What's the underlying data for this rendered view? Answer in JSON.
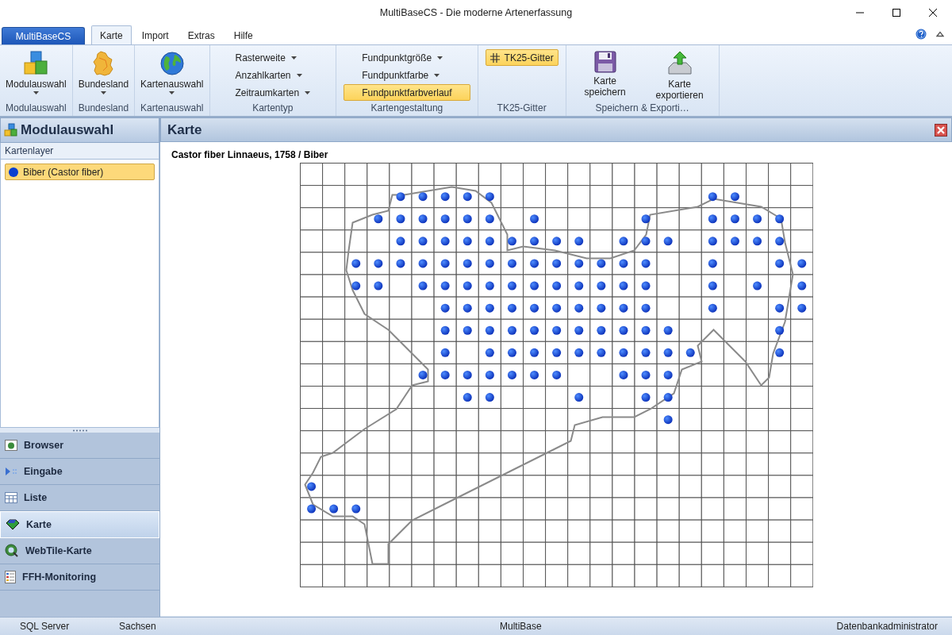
{
  "window": {
    "title": "MultiBaseCS - Die moderne Artenerfassung"
  },
  "ribbon": {
    "app_button": "MultiBaseCS",
    "tabs": [
      {
        "label": "Karte",
        "selected": true
      },
      {
        "label": "Import",
        "selected": false
      },
      {
        "label": "Extras",
        "selected": false
      },
      {
        "label": "Hilfe",
        "selected": false
      }
    ],
    "groups": [
      {
        "label": "Modulauswahl",
        "items": [
          {
            "kind": "large",
            "label": "Modulauswahl",
            "dropdown": true
          }
        ]
      },
      {
        "label": "Bundesland",
        "items": [
          {
            "kind": "large",
            "label": "Bundesland",
            "dropdown": true
          }
        ]
      },
      {
        "label": "Kartenauswahl",
        "items": [
          {
            "kind": "large",
            "label": "Kartenauswahl",
            "dropdown": true
          }
        ]
      },
      {
        "label": "Kartentyp",
        "items": [
          {
            "kind": "dropdown",
            "label": "Rasterweite"
          },
          {
            "kind": "dropdown",
            "label": "Anzahlkarten"
          },
          {
            "kind": "dropdown",
            "label": "Zeitraumkarten"
          }
        ]
      },
      {
        "label": "Kartengestaltung",
        "items": [
          {
            "kind": "dropdown",
            "label": "Fundpunktgröße"
          },
          {
            "kind": "dropdown",
            "label": "Fundpunktfarbe"
          },
          {
            "kind": "toggle",
            "label": "Fundpunktfarbverlauf",
            "selected": true
          }
        ]
      },
      {
        "label": "TK25-Gitter",
        "items": [
          {
            "kind": "toggle",
            "label": "TK25-Gitter",
            "selected": true
          }
        ]
      },
      {
        "label": "Speichern & Exporti…",
        "items": [
          {
            "kind": "large",
            "label": "Karte speichern"
          },
          {
            "kind": "large",
            "label": "Karte exportieren"
          }
        ]
      }
    ]
  },
  "sidebar": {
    "title": "Modulauswahl",
    "section": "Kartenlayer",
    "layers": [
      {
        "label": "Biber (Castor fiber)",
        "color": "#0a3fd0",
        "selected": true
      }
    ],
    "nav": [
      {
        "label": "Browser",
        "selected": false
      },
      {
        "label": "Eingabe",
        "selected": false
      },
      {
        "label": "Liste",
        "selected": false
      },
      {
        "label": "Karte",
        "selected": true
      },
      {
        "label": "WebTile-Karte",
        "selected": false
      },
      {
        "label": "FFH-Monitoring",
        "selected": false
      }
    ]
  },
  "panel": {
    "title": "Karte",
    "map": {
      "title": "Castor fiber Linnaeus, 1758 / Biber",
      "grid": [
        [
          false,
          false,
          false,
          false,
          false,
          false,
          false,
          false,
          false,
          false,
          false,
          false,
          false,
          false,
          false,
          false,
          false,
          false,
          false,
          false,
          false,
          false,
          false
        ],
        [
          false,
          false,
          false,
          false,
          true,
          true,
          true,
          true,
          true,
          false,
          false,
          false,
          false,
          false,
          false,
          false,
          false,
          false,
          true,
          true,
          false,
          false,
          false
        ],
        [
          false,
          false,
          false,
          true,
          true,
          true,
          true,
          true,
          true,
          false,
          true,
          false,
          false,
          false,
          false,
          true,
          false,
          false,
          true,
          true,
          true,
          true,
          false
        ],
        [
          false,
          false,
          false,
          false,
          true,
          true,
          true,
          true,
          true,
          true,
          true,
          true,
          true,
          false,
          true,
          true,
          true,
          false,
          true,
          true,
          true,
          true,
          false
        ],
        [
          false,
          false,
          true,
          true,
          true,
          true,
          true,
          true,
          true,
          true,
          true,
          true,
          true,
          true,
          true,
          true,
          false,
          false,
          true,
          false,
          false,
          true,
          true
        ],
        [
          false,
          false,
          true,
          true,
          false,
          true,
          true,
          true,
          true,
          true,
          true,
          true,
          true,
          true,
          true,
          true,
          false,
          false,
          true,
          false,
          true,
          false,
          true
        ],
        [
          false,
          false,
          false,
          false,
          false,
          false,
          true,
          true,
          true,
          true,
          true,
          true,
          true,
          true,
          true,
          true,
          false,
          false,
          true,
          false,
          false,
          true,
          true
        ],
        [
          false,
          false,
          false,
          false,
          false,
          false,
          true,
          true,
          true,
          true,
          true,
          true,
          true,
          true,
          true,
          true,
          true,
          false,
          false,
          false,
          false,
          true,
          false
        ],
        [
          false,
          false,
          false,
          false,
          false,
          false,
          true,
          false,
          true,
          true,
          true,
          true,
          true,
          true,
          true,
          true,
          true,
          true,
          false,
          false,
          false,
          true,
          false
        ],
        [
          false,
          false,
          false,
          false,
          false,
          true,
          true,
          true,
          true,
          true,
          true,
          true,
          false,
          false,
          true,
          true,
          true,
          false,
          false,
          false,
          false,
          false,
          false
        ],
        [
          false,
          false,
          false,
          false,
          false,
          false,
          false,
          true,
          true,
          false,
          false,
          false,
          true,
          false,
          false,
          true,
          true,
          false,
          false,
          false,
          false,
          false,
          false
        ],
        [
          false,
          false,
          false,
          false,
          false,
          false,
          false,
          false,
          false,
          false,
          false,
          false,
          false,
          false,
          false,
          false,
          true,
          false,
          false,
          false,
          false,
          false,
          false
        ],
        [
          false,
          false,
          false,
          false,
          false,
          false,
          false,
          false,
          false,
          false,
          false,
          false,
          false,
          false,
          false,
          false,
          false,
          false,
          false,
          false,
          false,
          false,
          false
        ],
        [
          false,
          false,
          false,
          false,
          false,
          false,
          false,
          false,
          false,
          false,
          false,
          false,
          false,
          false,
          false,
          false,
          false,
          false,
          false,
          false,
          false,
          false,
          false
        ],
        [
          true,
          false,
          false,
          false,
          false,
          false,
          false,
          false,
          false,
          false,
          false,
          false,
          false,
          false,
          false,
          false,
          false,
          false,
          false,
          false,
          false,
          false,
          false
        ],
        [
          true,
          true,
          true,
          false,
          false,
          false,
          false,
          false,
          false,
          false,
          false,
          false,
          false,
          false,
          false,
          false,
          false,
          false,
          false,
          false,
          false,
          false,
          false
        ],
        [
          false,
          false,
          false,
          false,
          false,
          false,
          false,
          false,
          false,
          false,
          false,
          false,
          false,
          false,
          false,
          false,
          false,
          false,
          false,
          false,
          false,
          false,
          false
        ],
        [
          false,
          false,
          false,
          false,
          false,
          false,
          false,
          false,
          false,
          false,
          false,
          false,
          false,
          false,
          false,
          false,
          false,
          false,
          false,
          false,
          false,
          false,
          false
        ],
        [
          false,
          false,
          false,
          false,
          false,
          false,
          false,
          false,
          false,
          false,
          false,
          false,
          false,
          false,
          false,
          false,
          false,
          false,
          false,
          false,
          false,
          false,
          false
        ]
      ]
    }
  },
  "status_bar": [
    "SQL Server",
    "Sachsen",
    "MultiBase",
    "Datenbankadministrator"
  ]
}
